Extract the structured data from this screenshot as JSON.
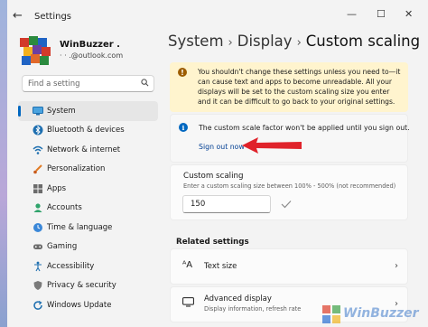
{
  "window": {
    "title": "Settings",
    "controls": {
      "minimize": "—",
      "maximize": "☐",
      "close": "✕"
    }
  },
  "user": {
    "name": "WinBuzzer .",
    "email_prefix": "·  ·",
    "email": ".@outlook.com"
  },
  "search": {
    "placeholder": "Find a setting"
  },
  "nav": {
    "items": [
      {
        "label": "System",
        "icon": "system-icon",
        "selected": true
      },
      {
        "label": "Bluetooth & devices",
        "icon": "bluetooth-icon"
      },
      {
        "label": "Network & internet",
        "icon": "network-icon"
      },
      {
        "label": "Personalization",
        "icon": "brush-icon"
      },
      {
        "label": "Apps",
        "icon": "apps-icon"
      },
      {
        "label": "Accounts",
        "icon": "accounts-icon"
      },
      {
        "label": "Time & language",
        "icon": "time-icon"
      },
      {
        "label": "Gaming",
        "icon": "gaming-icon"
      },
      {
        "label": "Accessibility",
        "icon": "accessibility-icon"
      },
      {
        "label": "Privacy & security",
        "icon": "shield-icon"
      },
      {
        "label": "Windows Update",
        "icon": "update-icon"
      }
    ]
  },
  "breadcrumb": {
    "part1": "System",
    "part2": "Display",
    "current": "Custom scaling",
    "separator": "›"
  },
  "warning": {
    "icon": "warning-icon",
    "text": "You shouldn't change these settings unless you need to—it can cause text and apps to become unreadable. All your displays will be set to the custom scaling size you enter and it can be difficult to go back to your original settings."
  },
  "info": {
    "icon": "info-icon",
    "text": "The custom scale factor won't be applied until you sign out.",
    "link": "Sign out now"
  },
  "custom_scaling": {
    "title": "Custom scaling",
    "description": "Enter a custom scaling size between 100% - 500% (not recommended)",
    "value": "150"
  },
  "related": {
    "heading": "Related settings",
    "rows": [
      {
        "title": "Text size",
        "icon": "text-size-icon",
        "glyph": "ᴬA"
      },
      {
        "title": "Advanced display",
        "subtitle": "Display information, refresh rate",
        "icon": "monitor-icon"
      }
    ]
  },
  "watermark": {
    "text": "WinBuzzer"
  },
  "colors": {
    "accent": "#0067c0",
    "warning_bg": "#fff4ce",
    "arrow": "#e0222a",
    "link": "#003e92"
  }
}
